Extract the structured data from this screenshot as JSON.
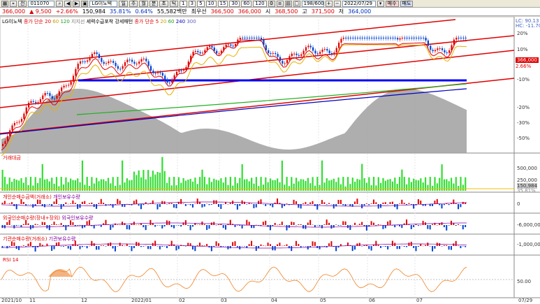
{
  "toolbar": {
    "icons": [
      "chart-icon",
      "pin-icon"
    ],
    "market": "전",
    "code": "011070",
    "search_icon": "search-icon",
    "arrows": [
      "◀",
      "▶"
    ],
    "name": "LG이노텍",
    "periods": [
      "일",
      "주",
      "월",
      "분",
      "초",
      "틱"
    ],
    "minutes": [
      "1",
      "3",
      "5",
      "10",
      "15",
      "30",
      "60",
      "120"
    ],
    "count": "198/600",
    "date": "2022/07/29",
    "btn_buy": "매수",
    "btn_sell": "매도"
  },
  "quote": {
    "price": "366,000",
    "change": "▲ 9,500",
    "pct": "+2.66%",
    "volume": "150,984",
    "ratio1": "35.81%",
    "ratio2": "0.64%",
    "amount": "55,582백만",
    "bid_label": "최우선",
    "bid": "366,500",
    "ask": "366,000",
    "open_label": "시",
    "open": "368,500",
    "high_label": "고",
    "high": "371,500",
    "low_label": "저",
    "low": "364,000"
  },
  "legend": {
    "name": "LG이노텍",
    "ma_label": "종가 단순",
    "ma_periods": [
      "20",
      "60",
      "120"
    ],
    "index_label": "지지선",
    "trend": "세력수급포착 강세패턴",
    "ma2_label": "종가 단순",
    "ma2_periods": [
      "5",
      "20",
      "60",
      "240",
      "300"
    ]
  },
  "price_axis": {
    "lc": "LC: 90.13",
    "hc": "HC: -11.70",
    "ticks": [
      "20%",
      "10%",
      "0%",
      "-10%",
      "-20%",
      "-30%",
      "-40%",
      "-50%"
    ],
    "current": "366,000",
    "current_pct": "2.66%"
  },
  "panels": {
    "volume": {
      "label": "거래대금",
      "ticks": [
        "500,000",
        "250,000"
      ],
      "last": "150,984",
      "last_pct": "35.81%"
    },
    "individual": {
      "label": "개인순매수금액(거래소)",
      "label2": "개인보유수량",
      "tick": "0"
    },
    "foreign": {
      "label": "외국인순매수량(장내+장외)",
      "label2": "외국인보유수량",
      "tick": "-6,000,000"
    },
    "institution": {
      "label": "기관순매수량(거래소)",
      "label2": "기관보유수량",
      "tick": "-1,000,000"
    },
    "rsi": {
      "label": "RSI 14",
      "tick": "50.00"
    }
  },
  "xaxis": [
    "2021/10",
    "11",
    "12",
    "2022/01",
    "02",
    "03",
    "04",
    "05",
    "06",
    "07",
    "07/29"
  ],
  "colors": {
    "up": "#e00000",
    "down": "#0040d0",
    "channel": "#e00000",
    "support": "#0000ff",
    "area": "#a0a0a0",
    "vol": "#33dd33"
  }
}
